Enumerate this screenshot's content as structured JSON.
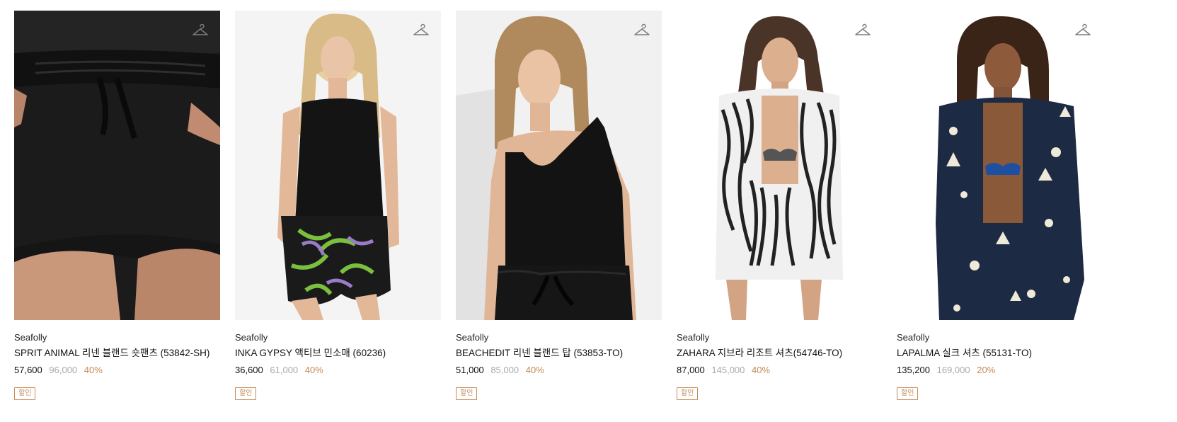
{
  "colors": {
    "discount": "#c58a55",
    "original_price": "#a9a9a9",
    "text": "#111111"
  },
  "products": [
    {
      "brand": "Seafolly",
      "name": "SPRIT ANIMAL 리넨 블랜드 숏팬츠 (53842-SH)",
      "sale_price": "57,600",
      "original_price": "96,000",
      "discount_rate": "40%",
      "badge": "할인",
      "wishlist_icon": "hanger-icon"
    },
    {
      "brand": "Seafolly",
      "name": "INKA GYPSY 액티브 민소매 (60236)",
      "sale_price": "36,600",
      "original_price": "61,000",
      "discount_rate": "40%",
      "badge": "할인",
      "wishlist_icon": "hanger-icon"
    },
    {
      "brand": "Seafolly",
      "name": "BEACHEDIT 리넨 블랜드 탑 (53853-TO)",
      "sale_price": "51,000",
      "original_price": "85,000",
      "discount_rate": "40%",
      "badge": "할인",
      "wishlist_icon": "hanger-icon"
    },
    {
      "brand": "Seafolly",
      "name": "ZAHARA 지브라 리조트 셔츠(54746-TO)",
      "sale_price": "87,000",
      "original_price": "145,000",
      "discount_rate": "40%",
      "badge": "할인",
      "wishlist_icon": "hanger-icon"
    },
    {
      "brand": "Seafolly",
      "name": "LAPALMA 실크 셔츠 (55131-TO)",
      "sale_price": "135,200",
      "original_price": "169,000",
      "discount_rate": "20%",
      "badge": "할인",
      "wishlist_icon": "hanger-icon"
    }
  ]
}
